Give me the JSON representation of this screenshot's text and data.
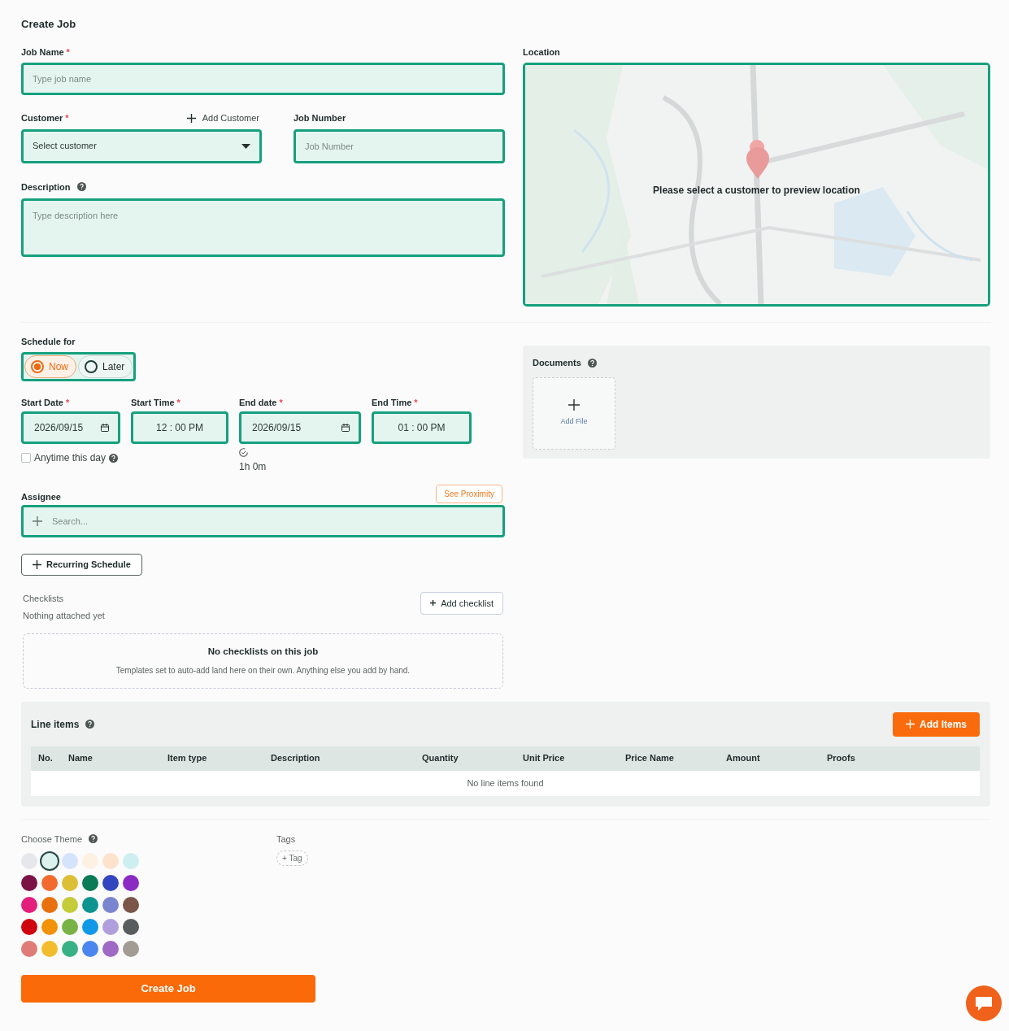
{
  "title": "Create Job",
  "job_name": {
    "label": "Job Name",
    "required_mark": "*",
    "placeholder": "Type job name"
  },
  "customer": {
    "label": "Customer",
    "required_mark": "*",
    "add_link": "Add Customer",
    "placeholder": "Select customer"
  },
  "job_number": {
    "label": "Job Number",
    "placeholder": "Job Number"
  },
  "description": {
    "label": "Description",
    "placeholder": "Type description here"
  },
  "location": {
    "label": "Location",
    "message": "Please select a customer to preview location"
  },
  "schedule": {
    "label": "Schedule for",
    "options": [
      {
        "label": "Now",
        "selected": true
      },
      {
        "label": "Later",
        "selected": false
      }
    ]
  },
  "datetime_fields": [
    {
      "kind": "date",
      "label": "Start Date",
      "required_mark": "*",
      "value": "2026/09/15"
    },
    {
      "kind": "time",
      "label": "Start Time",
      "required_mark": "*",
      "value": "12 : 00 PM"
    },
    {
      "kind": "date",
      "label": "End date",
      "required_mark": "*",
      "value": "2026/09/15"
    },
    {
      "kind": "time",
      "label": "End Time",
      "required_mark": "*",
      "value": "01 : 00 PM"
    }
  ],
  "anytime": {
    "label": "Anytime this day",
    "checked": false
  },
  "duration": "1h 0m",
  "assignee": {
    "label": "Assignee",
    "proximity_button": "See Proximity",
    "placeholder": "Search..."
  },
  "recurring_button": "Recurring Schedule",
  "checklists": {
    "label": "Checklists",
    "subtitle": "Nothing attached yet",
    "add_button": "Add checklist",
    "empty_title": "No checklists on this job",
    "empty_text": "Templates set to auto-add land here on their own. Anything else you add by hand."
  },
  "documents": {
    "label": "Documents",
    "add_file": "Add File"
  },
  "line_items": {
    "title": "Line items",
    "add_button": "Add Items",
    "table": {
      "columns": [
        "No.",
        "Name",
        "Item type",
        "Description",
        "Quantity",
        "Unit Price",
        "Price Name",
        "Amount",
        "Proofs"
      ],
      "empty_message": "No line items found"
    }
  },
  "theme": {
    "label": "Choose Theme",
    "swatches": [
      {
        "color": "#e5e7eb",
        "selected": false
      },
      {
        "color": "#ddf1ec",
        "selected": true
      },
      {
        "color": "#d6e4fb",
        "selected": false
      },
      {
        "color": "#fdf1e4",
        "selected": false
      },
      {
        "color": "#fde3cb",
        "selected": false
      },
      {
        "color": "#cdeff1",
        "selected": false
      },
      {
        "color": "#7b1246",
        "selected": false
      },
      {
        "color": "#f26a2d",
        "selected": false
      },
      {
        "color": "#dcbf34",
        "selected": false
      },
      {
        "color": "#0b7a57",
        "selected": false
      },
      {
        "color": "#3346c0",
        "selected": false
      },
      {
        "color": "#8b2bc4",
        "selected": false
      },
      {
        "color": "#e31e7c",
        "selected": false
      },
      {
        "color": "#e8700e",
        "selected": false
      },
      {
        "color": "#c4cc3a",
        "selected": false
      },
      {
        "color": "#0e948e",
        "selected": false
      },
      {
        "color": "#7a84cf",
        "selected": false
      },
      {
        "color": "#7a5548",
        "selected": false
      },
      {
        "color": "#d0040e",
        "selected": false
      },
      {
        "color": "#f29208",
        "selected": false
      },
      {
        "color": "#79b246",
        "selected": false
      },
      {
        "color": "#1198e6",
        "selected": false
      },
      {
        "color": "#b19edd",
        "selected": false
      },
      {
        "color": "#5a5d5e",
        "selected": false
      },
      {
        "color": "#e07c78",
        "selected": false
      },
      {
        "color": "#f2bc2c",
        "selected": false
      },
      {
        "color": "#38b184",
        "selected": false
      },
      {
        "color": "#4a86ed",
        "selected": false
      },
      {
        "color": "#9e6ac4",
        "selected": false
      },
      {
        "color": "#a39c95",
        "selected": false
      }
    ]
  },
  "tags": {
    "label": "Tags",
    "add_tag": "+ Tag"
  },
  "submit_button": "Create Job"
}
